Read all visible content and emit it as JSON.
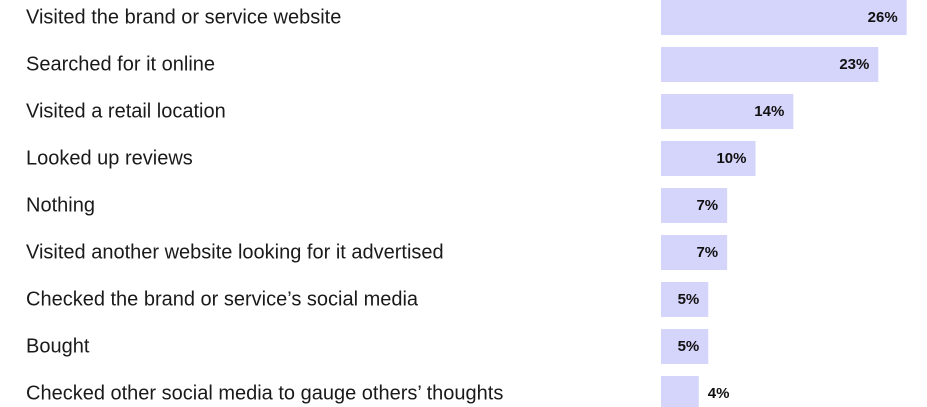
{
  "chart_data": {
    "type": "bar",
    "orientation": "horizontal",
    "categories": [
      "Visited the brand or service website",
      "Searched for it online",
      "Visited a retail location",
      "Looked up reviews",
      "Nothing",
      "Visited another website looking for it advertised",
      "Checked the brand or service’s social media",
      "Bought",
      "Checked other social media to gauge others’ thoughts"
    ],
    "values": [
      26,
      23,
      14,
      10,
      7,
      7,
      5,
      5,
      4
    ],
    "value_labels": [
      "26%",
      "23%",
      "14%",
      "10%",
      "7%",
      "7%",
      "5%",
      "5%",
      "4%"
    ],
    "unit": "%",
    "grid": false,
    "bar_color": "#d5d5fb",
    "text_color": "#1a1a1a"
  }
}
